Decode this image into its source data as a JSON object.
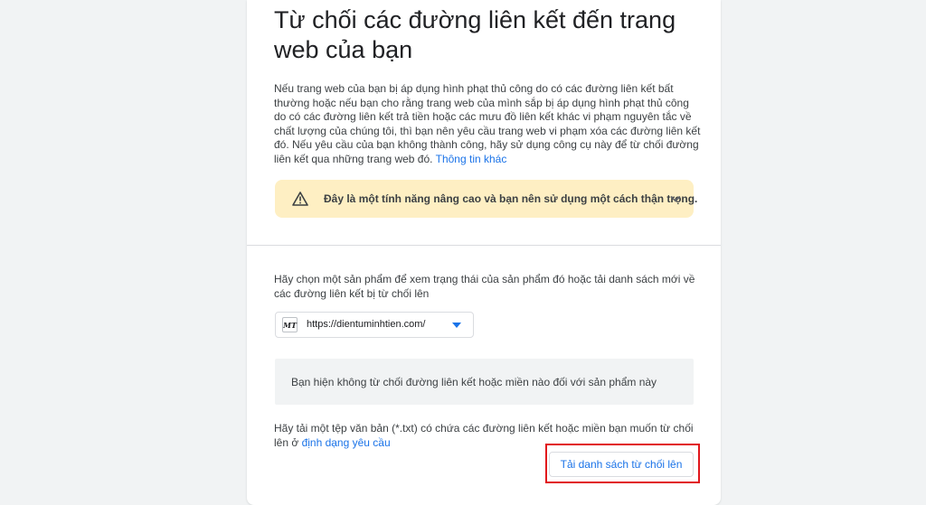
{
  "page": {
    "title": "Từ chối các đường liên kết đến trang web của bạn",
    "description": "Nếu trang web của bạn bị áp dụng hình phạt thủ công do có các đường liên kết bất thường hoặc nếu bạn cho rằng trang web của mình sắp bị áp dụng hình phạt thủ công do có các đường liên kết trả tiền hoặc các mưu đồ liên kết khác vi phạm nguyên tắc về chất lượng của chúng tôi, thì bạn nên yêu cầu trang web vi phạm xóa các đường liên kết đó. Nếu yêu cầu của bạn không thành công, hãy sử dụng công cụ này để từ chối đường liên kết qua những trang web đó.",
    "more_info_link": "Thông tin khác"
  },
  "warning": {
    "text": "Đây là một tính năng nâng cao và bạn nên sử dụng một cách thận trọng.",
    "icon": "warning-triangle-icon",
    "background": "#feefc3"
  },
  "property": {
    "prompt": "Hãy chọn một sản phẩm để xem trạng thái của sản phẩm đó hoặc tải danh sách mới về các đường liên kết bị từ chối lên",
    "favicon_text": "MT",
    "selected": "https://dientuminhtien.com/"
  },
  "status": {
    "text": "Bạn hiện không từ chối đường liên kết hoặc miền nào đối với sản phẩm này"
  },
  "upload": {
    "text": "Hãy tải một tệp văn bản (*.txt) có chứa các đường liên kết hoặc miền bạn muốn từ chối lên ở",
    "format_link": "định dạng yêu cầu",
    "button_label": "Tải danh sách từ chối lên"
  },
  "colors": {
    "accent": "#1a73e8",
    "highlight": "#e1161b"
  }
}
